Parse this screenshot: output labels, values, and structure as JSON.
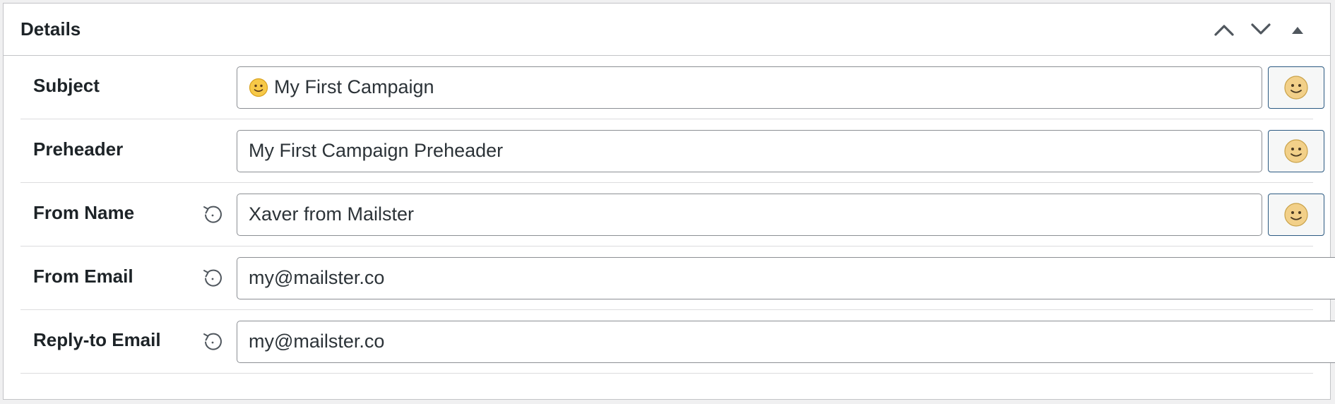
{
  "panel": {
    "title": "Details"
  },
  "rows": [
    {
      "label": "Subject",
      "value": "My First Campaign",
      "has_reset": false,
      "has_emoji_button": true,
      "has_inline_emoji": true
    },
    {
      "label": "Preheader",
      "value": "My First Campaign Preheader",
      "has_reset": false,
      "has_emoji_button": true,
      "has_inline_emoji": false
    },
    {
      "label": "From Name",
      "value": "Xaver from Mailster",
      "has_reset": true,
      "has_emoji_button": true,
      "has_inline_emoji": false
    },
    {
      "label": "From Email",
      "value": "my@mailster.co",
      "has_reset": true,
      "has_emoji_button": false,
      "has_inline_emoji": false
    },
    {
      "label": "Reply-to Email",
      "value": "my@mailster.co",
      "has_reset": true,
      "has_emoji_button": false,
      "has_inline_emoji": false
    }
  ],
  "icons": {
    "move_up": "chevron-up-icon",
    "move_down": "chevron-down-icon",
    "toggle": "triangle-up-icon",
    "reset": "reset-icon",
    "emoji": "smiley-icon"
  },
  "colors": {
    "border": "#c3c4c7",
    "text": "#1d2327",
    "input_border": "#8c8f94",
    "emoji_button_border": "#2c5a82",
    "emoji_face": "#f2d089"
  }
}
